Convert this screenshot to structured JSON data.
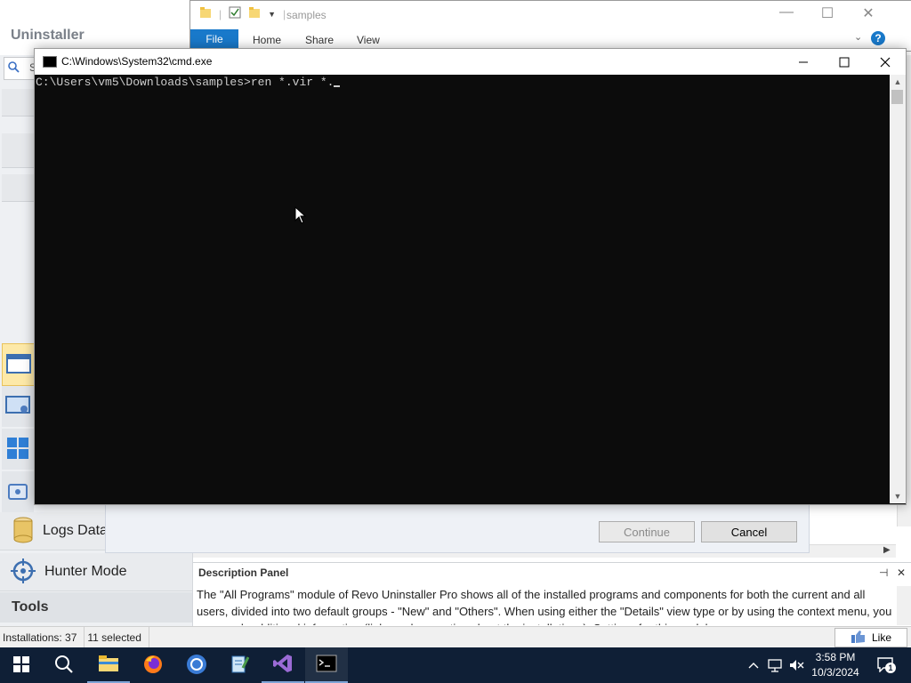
{
  "revo": {
    "title": "Uninstaller",
    "search_partial": "S",
    "modules": {
      "logs": "Logs Data",
      "hunter": "Hunter Mode",
      "tools": "Tools"
    },
    "description_panel": {
      "title": "Description Panel",
      "pin": "⊣",
      "close": "✕",
      "text": "The \"All Programs\" module of Revo Uninstaller Pro shows all of the installed programs and components for both the current and all users, divided into two default groups - \"New\" and \"Others\". When using either the \"Details\" view type or by using the context menu, you can reach additional information (links and properties about the installations). Settings for this module..."
    },
    "status": {
      "installations": "Installations: 37",
      "selected": "11 selected"
    },
    "like_label": "Like",
    "dialog": {
      "continue": "Continue",
      "cancel": "Cancel"
    }
  },
  "explorer": {
    "path": "samples",
    "tabs": {
      "file": "File",
      "home": "Home",
      "share": "Share",
      "view": "View"
    },
    "help": "?"
  },
  "cmd": {
    "title": "C:\\Windows\\System32\\cmd.exe",
    "line": "C:\\Users\\vm5\\Downloads\\samples>ren *.vir *."
  },
  "taskbar": {
    "time": "3:58 PM",
    "date": "10/3/2024",
    "notification_count": "1"
  },
  "colors": {
    "taskbar": "#0f1f36",
    "explorer_file_tab": "#1979ca",
    "cmd_background": "#0c0c0c",
    "cmd_text": "#cccccc"
  }
}
